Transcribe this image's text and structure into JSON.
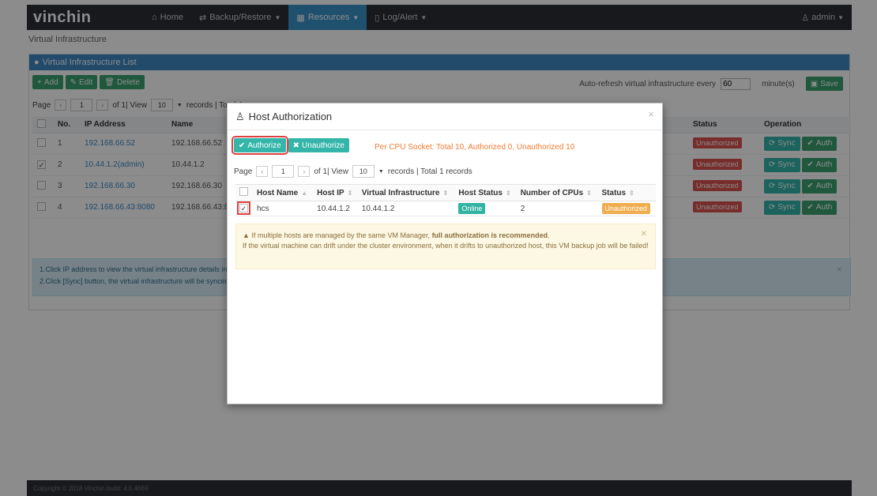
{
  "nav": {
    "brand": "vinchin",
    "items": [
      {
        "icon": "home-icon",
        "glyph": "⌂",
        "label": "Home"
      },
      {
        "icon": "backup-icon",
        "glyph": "⇄",
        "label": "Backup/Restore"
      },
      {
        "icon": "resources-icon",
        "glyph": "▦",
        "label": "Resources"
      },
      {
        "icon": "log-icon",
        "glyph": "▯",
        "label": "Log/Alert"
      }
    ],
    "user": "admin"
  },
  "breadcrumb": "Virtual Infrastructure",
  "panel": {
    "title": "Virtual Infrastructure List",
    "add": "Add",
    "edit": "Edit",
    "delete": "Delete",
    "autorefresh_label": "Auto-refresh virtual infrastructure every",
    "autorefresh_value": "60",
    "autorefresh_unit": "minute(s)",
    "save": "Save"
  },
  "pager": {
    "page_label": "Page",
    "page": "1",
    "of": "of 1| View",
    "view": "10",
    "records": "records | Total 4"
  },
  "main_table": {
    "headers": [
      "No.",
      "IP Address",
      "Name",
      "Status",
      "Operation"
    ],
    "rows": [
      {
        "no": "1",
        "ip": "192.168.66.52",
        "name": "192.168.66.52",
        "checked": false,
        "status": "Unauthorized"
      },
      {
        "no": "2",
        "ip": "10.44.1.2(admin)",
        "name": "10.44.1.2",
        "checked": true,
        "status": "Unauthorized"
      },
      {
        "no": "3",
        "ip": "192.168.66.30",
        "name": "192.168.66.30",
        "checked": false,
        "status": "Unauthorized"
      },
      {
        "no": "4",
        "ip": "192.168.66.43:8080",
        "name": "192.168.66.43:8",
        "checked": false,
        "status": "Unauthorized"
      }
    ],
    "sync": "Sync",
    "auth": "Auth"
  },
  "info": {
    "line1": "1.Click IP address to view the virtual infrastructure details incl",
    "line2": "2.Click [Sync] button, the virtual infrastructure will be synced t"
  },
  "footer": "Copyright © 2018 Vinchin build: 4.0.4669",
  "modal": {
    "title": "Host Authorization",
    "authorize": "Authorize",
    "unauthorize": "Unauthorize",
    "note": "Per CPU Socket: Total 10, Authorized 0, Unauthorized 10",
    "pager": {
      "page_label": "Page",
      "page": "1",
      "of": "of 1| View",
      "view": "10",
      "records": "records | Total 1 records"
    },
    "headers": [
      "Host Name",
      "Host IP",
      "Virtual Infrastructure",
      "Host Status",
      "Number of CPUs",
      "Status"
    ],
    "row": {
      "host": "hcs",
      "ip": "10.44.1.2",
      "vi": "10.44.1.2",
      "host_status": "Online",
      "cpus": "2",
      "status": "Unauthorized"
    },
    "warning_pre": "If multiple hosts are managed by the same VM Manager, ",
    "warning_bold": "full authorization is recommended",
    "warning_dot": ".",
    "warning_line2": "If the virtual machine can drift under the cluster environment, when it drifts to unauthorized host, this VM backup job will be failed!"
  }
}
